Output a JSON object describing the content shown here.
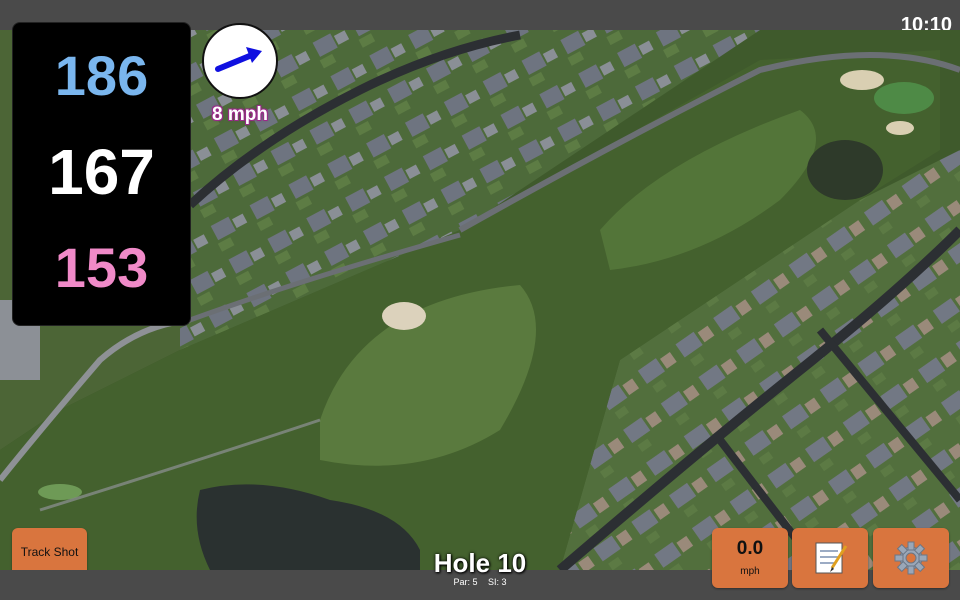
{
  "status": {
    "clock": "10:10"
  },
  "yardage": {
    "back": {
      "value": "186",
      "color": "#7ab6ee"
    },
    "middle": {
      "value": "167",
      "color": "#ffffff"
    },
    "front": {
      "value": "153",
      "color": "#f08ac8"
    }
  },
  "wind": {
    "speed": "8 mph",
    "arrow_color": "#1010e0",
    "icon": "wind-arrow-icon"
  },
  "hole": {
    "title": "Hole 10",
    "par": "Par: 5",
    "stroke_index": "SI: 3"
  },
  "buttons": {
    "track_shot": "Track Shot",
    "speed_value": "0.0",
    "speed_unit": "mph",
    "notes_icon": "notepad-icon",
    "settings_icon": "gear-icon"
  },
  "colors": {
    "button": "#d9753e",
    "bar": "#4a4a4a"
  }
}
